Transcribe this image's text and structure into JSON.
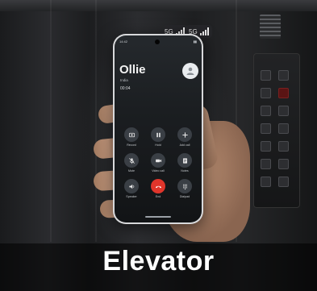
{
  "scene": {
    "caption": "Elevator"
  },
  "signal_tags": [
    {
      "network": "5G"
    },
    {
      "network": "5G"
    }
  ],
  "phone": {
    "status": {
      "time": "14:42",
      "right": ""
    },
    "call": {
      "name": "Ollie",
      "country": "India",
      "timer": "00:04"
    },
    "controls": [
      {
        "label": "Record",
        "icon": "record-icon"
      },
      {
        "label": "Hold",
        "icon": "pause-icon"
      },
      {
        "label": "Add call",
        "icon": "plus-icon"
      },
      {
        "label": "Mute",
        "icon": "mic-off-icon"
      },
      {
        "label": "Video call",
        "icon": "video-icon"
      },
      {
        "label": "Notes",
        "icon": "notes-icon"
      },
      {
        "label": "Speaker",
        "icon": "speaker-icon"
      },
      {
        "label": "End",
        "icon": "end-call-icon",
        "color": "#e0352b"
      },
      {
        "label": "Dialpad",
        "icon": "dialpad-icon"
      }
    ]
  }
}
